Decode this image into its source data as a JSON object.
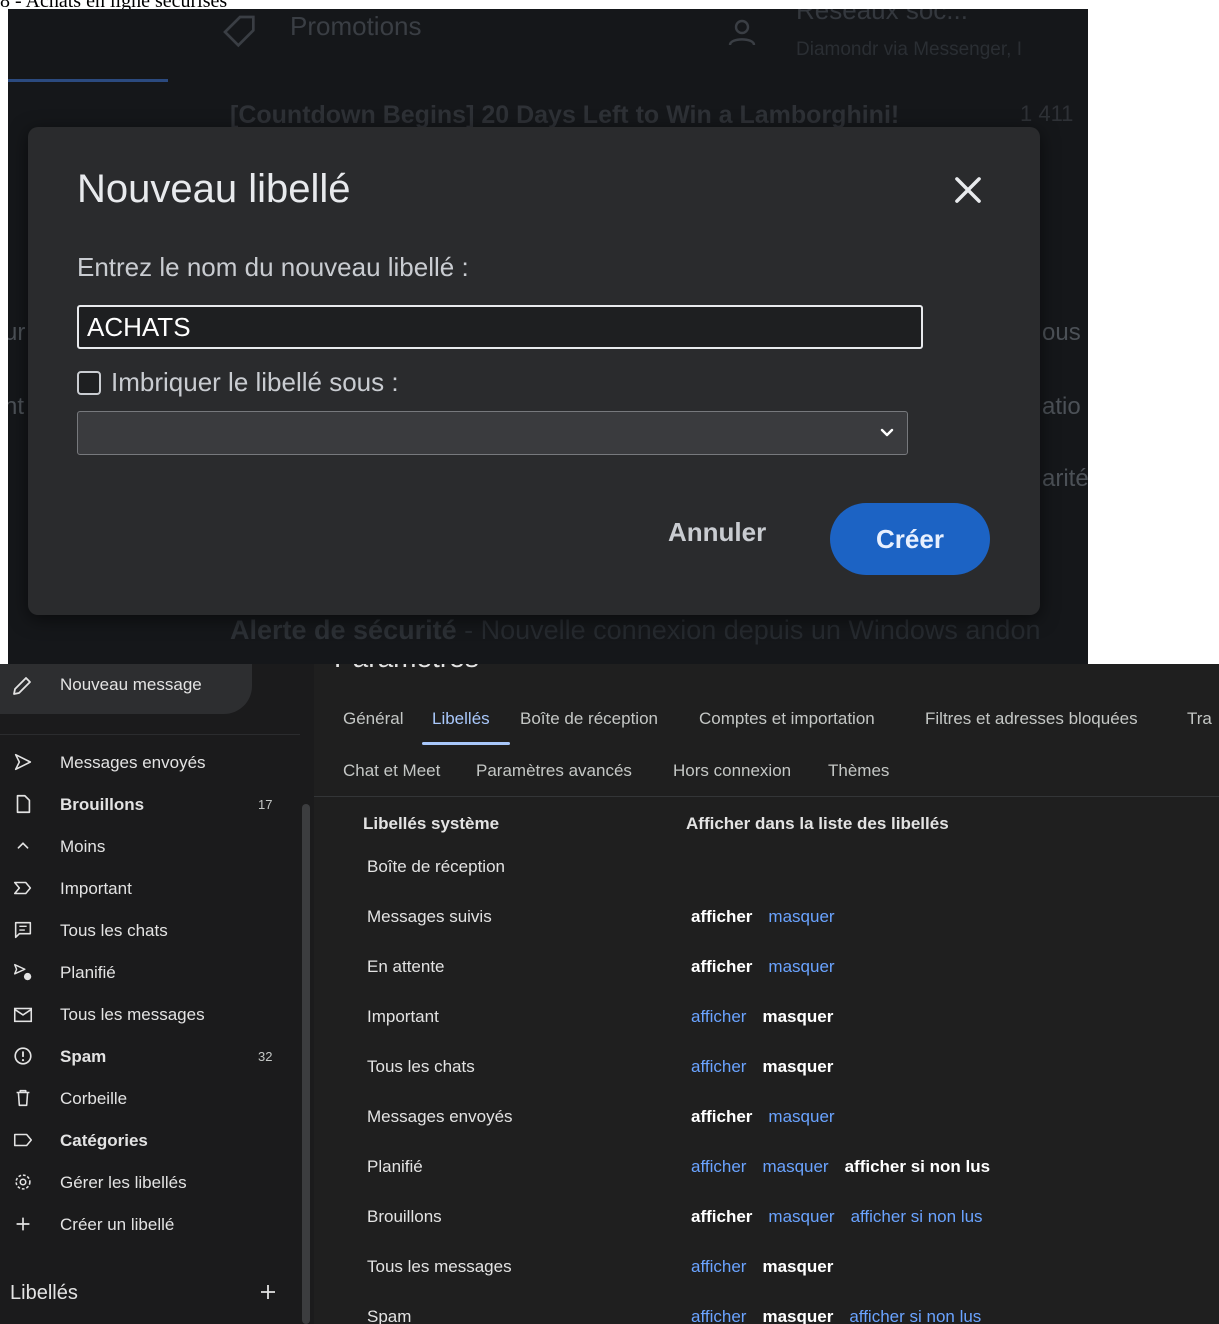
{
  "caption": "8 - Achats en ligne sécurisés",
  "background": {
    "tab_promotions": "Promotions",
    "social_title": "Réseaux soc...",
    "social_sub": "Diamondr via Messenger, I",
    "subject": "[Countdown Begins] 20 Days Left to Win a Lamborghini!",
    "count": "1 411",
    "fragment_left_1": "ur",
    "fragment_left_2": "nt",
    "fragment_right_1": "ous",
    "fragment_right_2": "atio",
    "fragment_right_3": "arité",
    "alert_bold": "Alerte de sécurité",
    "alert_rest": " - Nouvelle connexion depuis un Windows andon"
  },
  "dialog": {
    "title": "Nouveau libellé",
    "prompt": "Entrez le nom du nouveau libellé :",
    "input_value": "ACHATS",
    "nest_label": "Imbriquer le libellé sous :",
    "nest_checked": false,
    "select_value": "",
    "cancel_label": "Annuler",
    "create_label": "Créer",
    "accent_color": "#1c63c4"
  },
  "sidebar": {
    "compose_label": "Nouveau message",
    "items": [
      {
        "label": "Messages envoyés",
        "icon": "send-icon",
        "bold": false,
        "count": ""
      },
      {
        "label": "Brouillons",
        "icon": "draft-icon",
        "bold": true,
        "count": "17"
      },
      {
        "label": "Moins",
        "icon": "chevron-up-icon",
        "bold": false,
        "count": ""
      },
      {
        "label": "Important",
        "icon": "important-icon",
        "bold": false,
        "count": ""
      },
      {
        "label": "Tous les chats",
        "icon": "chat-icon",
        "bold": false,
        "count": ""
      },
      {
        "label": "Planifié",
        "icon": "scheduled-icon",
        "bold": false,
        "count": ""
      },
      {
        "label": "Tous les messages",
        "icon": "all-mail-icon",
        "bold": false,
        "count": ""
      },
      {
        "label": "Spam",
        "icon": "spam-icon",
        "bold": true,
        "count": "32"
      },
      {
        "label": "Corbeille",
        "icon": "trash-icon",
        "bold": false,
        "count": ""
      },
      {
        "label": "Catégories",
        "icon": "label-icon",
        "bold": true,
        "count": ""
      },
      {
        "label": "Gérer les libellés",
        "icon": "gear-icon",
        "bold": false,
        "count": ""
      },
      {
        "label": "Créer un libellé",
        "icon": "plus-icon",
        "bold": false,
        "count": ""
      }
    ],
    "labels_title": "Libellés"
  },
  "settings": {
    "title": "Paramètres",
    "tabs_row1": [
      "Général",
      "Libellés",
      "Boîte de réception",
      "Comptes et importation",
      "Filtres et adresses bloquées",
      "Tra"
    ],
    "tabs_row2": [
      "Chat et Meet",
      "Paramètres avancés",
      "Hors connexion",
      "Thèmes"
    ],
    "active_tab": "Libellés",
    "col_system_labels": "Libellés système",
    "col_show_in_list": "Afficher dans la liste des libellés",
    "rows": [
      {
        "name": "Boîte de réception",
        "actions": []
      },
      {
        "name": "Messages suivis",
        "actions": [
          {
            "text": "afficher",
            "selected": true
          },
          {
            "text": "masquer",
            "selected": false
          }
        ]
      },
      {
        "name": "En attente",
        "actions": [
          {
            "text": "afficher",
            "selected": true
          },
          {
            "text": "masquer",
            "selected": false
          }
        ]
      },
      {
        "name": "Important",
        "actions": [
          {
            "text": "afficher",
            "selected": false
          },
          {
            "text": "masquer",
            "selected": true
          }
        ]
      },
      {
        "name": "Tous les chats",
        "actions": [
          {
            "text": "afficher",
            "selected": false
          },
          {
            "text": "masquer",
            "selected": true
          }
        ]
      },
      {
        "name": "Messages envoyés",
        "actions": [
          {
            "text": "afficher",
            "selected": true
          },
          {
            "text": "masquer",
            "selected": false
          }
        ]
      },
      {
        "name": "Planifié",
        "actions": [
          {
            "text": "afficher",
            "selected": false
          },
          {
            "text": "masquer",
            "selected": false
          },
          {
            "text": "afficher si non lus",
            "selected": true
          }
        ]
      },
      {
        "name": "Brouillons",
        "actions": [
          {
            "text": "afficher",
            "selected": true
          },
          {
            "text": "masquer",
            "selected": false
          },
          {
            "text": "afficher si non lus",
            "selected": false
          }
        ]
      },
      {
        "name": "Tous les messages",
        "actions": [
          {
            "text": "afficher",
            "selected": false
          },
          {
            "text": "masquer",
            "selected": true
          }
        ]
      },
      {
        "name": "Spam",
        "actions": [
          {
            "text": "afficher",
            "selected": false
          },
          {
            "text": "masquer",
            "selected": true
          },
          {
            "text": "afficher si non lus",
            "selected": false
          }
        ]
      }
    ],
    "link_color": "#6aa3ff"
  }
}
